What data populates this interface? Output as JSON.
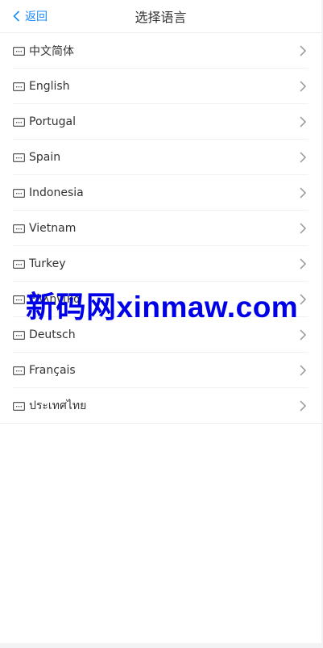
{
  "navbar": {
    "back_label": "返回",
    "title": "选择语言"
  },
  "languages": [
    {
      "label": "中文简体"
    },
    {
      "label": "English"
    },
    {
      "label": "Portugal"
    },
    {
      "label": "Spain"
    },
    {
      "label": "Indonesia"
    },
    {
      "label": "Vietnam"
    },
    {
      "label": "Turkey"
    },
    {
      "label": "Ελληνικά"
    },
    {
      "label": "Deutsch"
    },
    {
      "label": "Français"
    },
    {
      "label": "ประเทศไทย"
    }
  ],
  "watermark": "新码网xinmaw.com",
  "colors": {
    "accent": "#1989fa",
    "watermark": "#0000e8"
  }
}
